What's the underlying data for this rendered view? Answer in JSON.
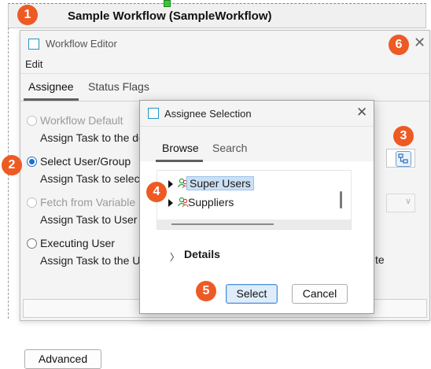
{
  "canvas": {
    "title": "Sample Workflow (SampleWorkflow)"
  },
  "callouts": [
    "1",
    "2",
    "3",
    "4",
    "5",
    "6"
  ],
  "editor": {
    "title": "Workflow Editor",
    "close_glyph": "✕",
    "menu": {
      "edit": "Edit"
    },
    "tabs": [
      {
        "label": "Assignee",
        "active": true
      },
      {
        "label": "Status Flags",
        "active": false
      }
    ],
    "options": [
      {
        "label": "Workflow Default",
        "description": "Assign Task to the de",
        "enabled": false,
        "checked": false
      },
      {
        "label": "Select User/Group",
        "description": "Assign Task to selecte",
        "enabled": true,
        "checked": true
      },
      {
        "label": "Fetch from Variable",
        "description": "Assign Task to User o",
        "enabled": false,
        "checked": false
      },
      {
        "label": "Executing User",
        "description": "Assign Task to the Us",
        "description_suffix": "te",
        "enabled": true,
        "checked": false
      }
    ],
    "advanced_button": "Advanced",
    "combo_arrow": "∨"
  },
  "dialog": {
    "title": "Assignee Selection",
    "close_glyph": "✕",
    "tabs": [
      {
        "label": "Browse",
        "active": true
      },
      {
        "label": "Search",
        "active": false
      }
    ],
    "tree": [
      {
        "label": "Super Users",
        "selected": true,
        "icon": "user-group-icon"
      },
      {
        "label": "Suppliers",
        "selected": false,
        "icon": "user-group-icon"
      }
    ],
    "details": {
      "label": "Details",
      "chevron": "〉"
    },
    "select_button": "Select",
    "cancel_button": "Cancel"
  },
  "colors": {
    "callout": "#ee5a24",
    "accent": "#1c6fc9",
    "selection": "#cce0f5",
    "window_icon": "#2196c9"
  }
}
